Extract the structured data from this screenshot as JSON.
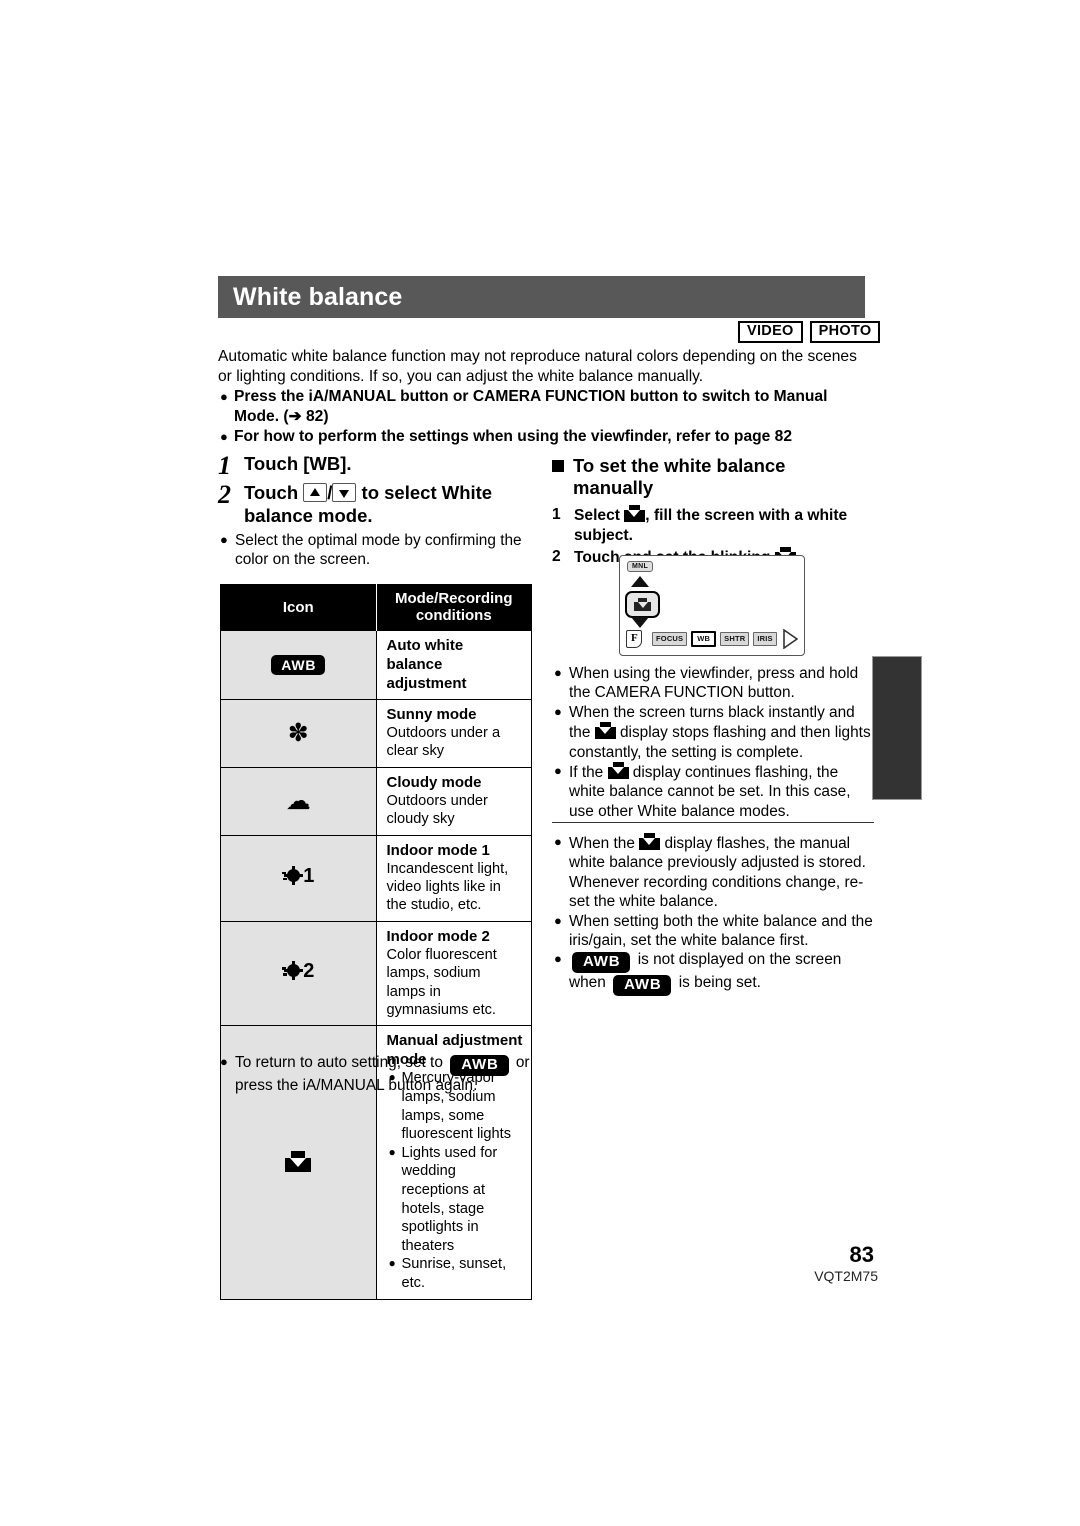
{
  "header": {
    "title": "White balance",
    "badges": [
      "VIDEO",
      "PHOTO"
    ]
  },
  "intro": {
    "paragraph": "Automatic white balance function may not reproduce natural colors depending on the scenes or lighting conditions. If so, you can adjust the white balance manually.",
    "bullets": [
      "Press the iA/MANUAL button or CAMERA FUNCTION button to switch to Manual Mode. (➔ 82)",
      "For how to perform the settings when using the viewfinder, refer to page 82"
    ]
  },
  "left": {
    "steps": [
      {
        "num": "1",
        "text_before": "Touch [WB].",
        "text_after": ""
      },
      {
        "num": "2",
        "text_before": "Touch",
        "text_after": "to select White balance mode."
      }
    ],
    "step2_sep": "/",
    "note": "Select the optimal mode by confirming the color on the screen.",
    "table": {
      "headers": [
        "Icon",
        "Mode/Recording conditions"
      ],
      "rows": [
        {
          "icon": "awb-badge",
          "icon_label": "AWB",
          "title": "Auto white balance adjustment",
          "text": "",
          "list": []
        },
        {
          "icon": "sun-icon",
          "icon_label": "",
          "title": "Sunny mode",
          "text": "Outdoors under a clear sky",
          "list": []
        },
        {
          "icon": "cloud-icon",
          "icon_label": "",
          "title": "Cloudy mode",
          "text": "Outdoors under cloudy sky",
          "list": []
        },
        {
          "icon": "indoor1-icon",
          "icon_label": "1",
          "title": "Indoor mode 1",
          "text": "Incandescent light, video lights like in the studio, etc.",
          "list": []
        },
        {
          "icon": "indoor2-icon",
          "icon_label": "2",
          "title": "Indoor mode 2",
          "text": "Color fluorescent lamps, sodium lamps in gymnasiums etc.",
          "list": []
        },
        {
          "icon": "manual-wb-icon",
          "icon_label": "",
          "title": "Manual adjustment mode",
          "text": "",
          "list": [
            "Mercury-vapor lamps, sodium lamps, some fluorescent lights",
            "Lights used for wedding receptions at hotels, stage spotlights in theaters",
            "Sunrise, sunset, etc."
          ]
        }
      ]
    },
    "table_note_a": "To return to auto setting, set to",
    "table_note_badge": "AWB",
    "table_note_b": "or press the iA/MANUAL button again."
  },
  "right": {
    "section_title": "To set the white balance manually",
    "steps": [
      {
        "num": "1",
        "a": "Select",
        "b": ", fill the screen with a white subject."
      },
      {
        "num": "2",
        "a": "Touch and set the blinking",
        "b": "."
      }
    ],
    "lcd": {
      "mode_label": "MNL",
      "buttons": [
        "FOCUS",
        "WB",
        "SHTR",
        "IRIS"
      ],
      "selected_button": "WB"
    },
    "notes_top": [
      {
        "a": "When using the viewfinder, press and hold the CAMERA FUNCTION button.",
        "icon": false
      },
      {
        "a": "When the screen turns black instantly and the",
        "b": "display stops flashing and then lights constantly, the setting is complete.",
        "icon": true
      },
      {
        "a": "If the",
        "b": "display continues flashing, the white balance cannot be set. In this case, use other White balance modes.",
        "icon": true
      }
    ],
    "notes_bottom": [
      {
        "a": "When the",
        "b": "display flashes, the manual white balance previously adjusted is stored. Whenever recording conditions change, re-set the white balance.",
        "icon": true
      },
      {
        "a": "When setting both the white balance and the iris/gain, set the white balance first.",
        "icon": false
      }
    ],
    "awb_note": {
      "badge": "AWB",
      "a": "is not displayed on the screen when",
      "b": "is being set."
    }
  },
  "footer": {
    "page_number": "83",
    "doc_code": "VQT2M75"
  },
  "colors": {
    "header_bar": "#585858",
    "table_header": "#000000",
    "icon_cell": "#e2e2e2",
    "side_tab": "#333333"
  }
}
